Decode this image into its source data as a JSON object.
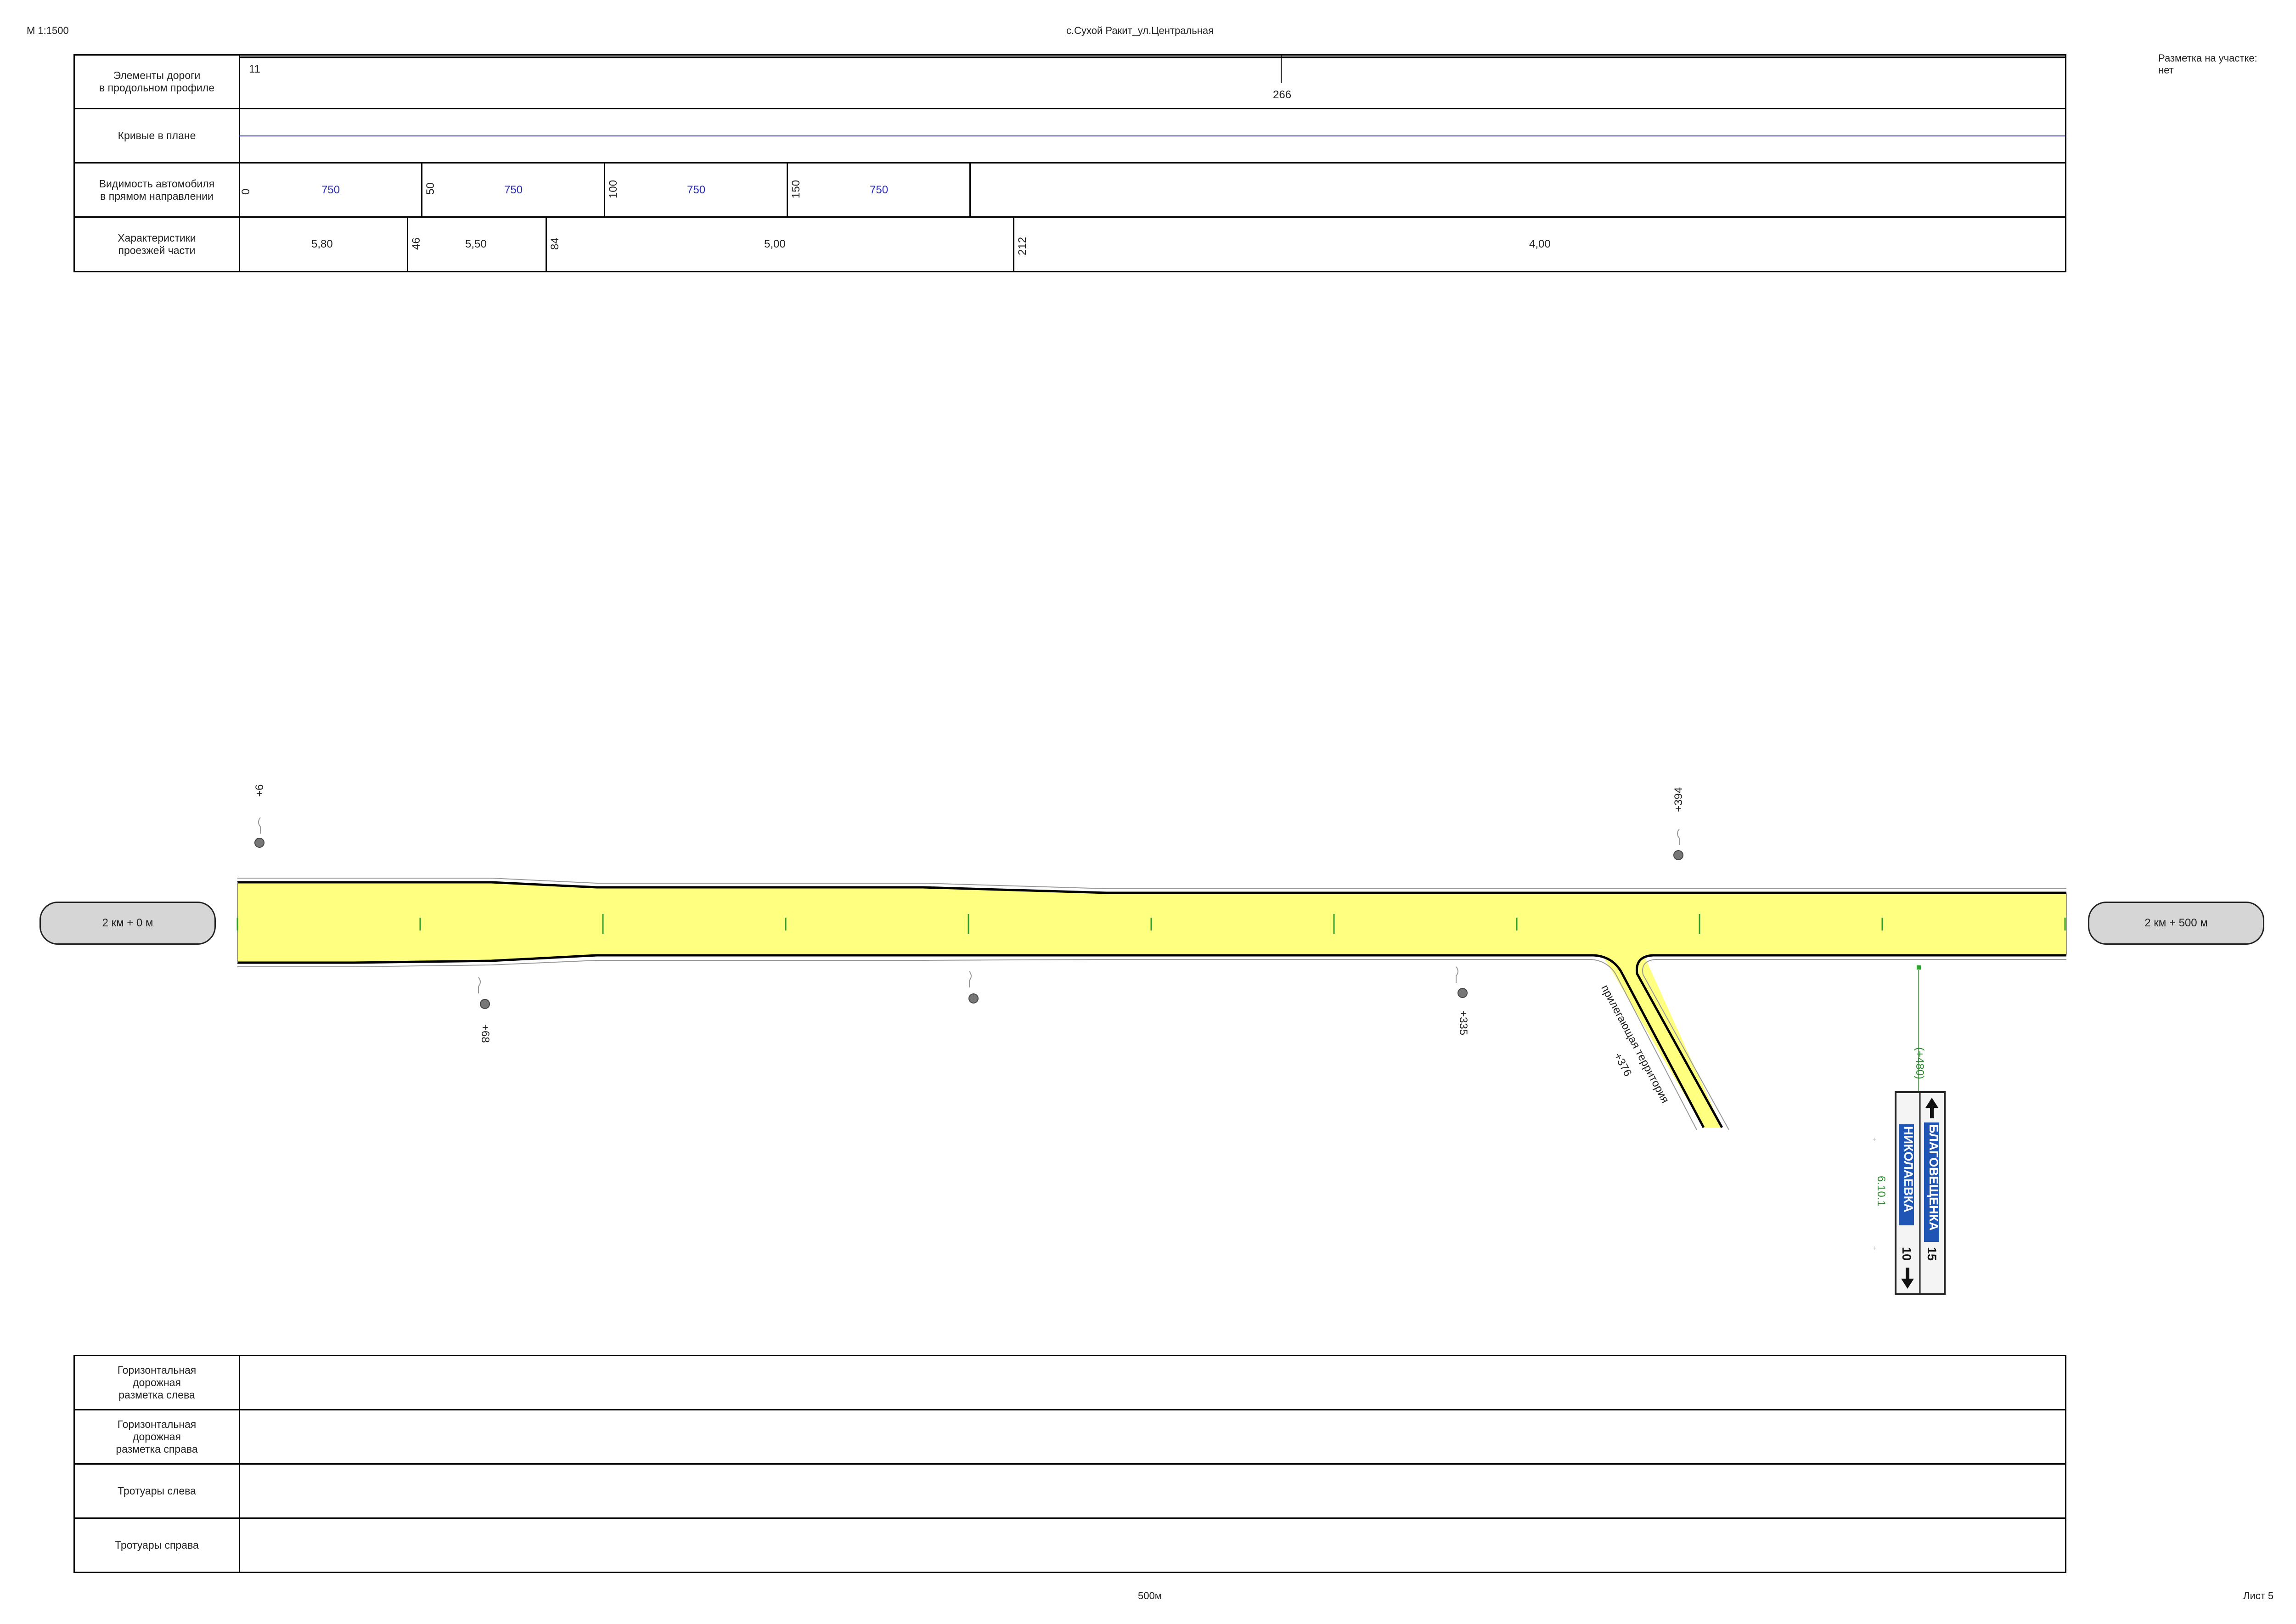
{
  "header": {
    "scale": "М 1:1500",
    "title": "с.Сухой Ракит_ул.Центральная",
    "marking_label": "Разметка на участке:",
    "marking_value": "нет"
  },
  "top_table": {
    "rows": [
      {
        "label": "Элементы дороги\nв продольном профиле"
      },
      {
        "label": "Кривые в плане"
      },
      {
        "label": "Видимость автомобиля\nв прямом направлении"
      },
      {
        "label": "Характеристики\nпроезжей части"
      }
    ],
    "profile": {
      "start": "11",
      "point": "266"
    },
    "visibility": {
      "marks": [
        "0",
        "50",
        "100",
        "150"
      ],
      "values": [
        "750",
        "750",
        "750",
        "750"
      ]
    },
    "carriageway": {
      "marks": [
        "46",
        "84",
        "212"
      ],
      "widths": [
        "5,80",
        "5,50",
        "5,00",
        "4,00"
      ]
    }
  },
  "plan": {
    "start_chip": "2 км + 0 м",
    "end_chip": "2 км + 500 м",
    "objects_left": [
      {
        "label": "+6"
      },
      {
        "label": "+394"
      }
    ],
    "objects_right": [
      {
        "label": "+68"
      },
      {
        "label": "+335"
      }
    ],
    "adjacent": {
      "label": "прилегающая территория",
      "chainage": "+376"
    },
    "sign": {
      "chainage": "(+480)",
      "code": "6.10.1",
      "top_dest": "БЛАГОВЕЩЕНКА",
      "top_dist": "15",
      "bottom_dest": "НИКОЛАЕВКА",
      "bottom_dist": "10",
      "colors": {
        "plate": "#1f55b5",
        "frame": "#222222",
        "bg": "#f4f4f4"
      }
    },
    "colors": {
      "road": "#ffff80",
      "center_tick": "#2e9e2e",
      "chip": "#d6d6d6",
      "label_green": "#2e8b2e"
    }
  },
  "bottom_table": {
    "rows": [
      {
        "label": "Горизонтальная\nдорожная\nразметка слева"
      },
      {
        "label": "Горизонтальная\nдорожная\nразметка справа"
      },
      {
        "label": "Тротуары слева"
      },
      {
        "label": "Тротуары справа"
      }
    ]
  },
  "footer": {
    "length": "500м",
    "sheet": "Лист 5"
  }
}
